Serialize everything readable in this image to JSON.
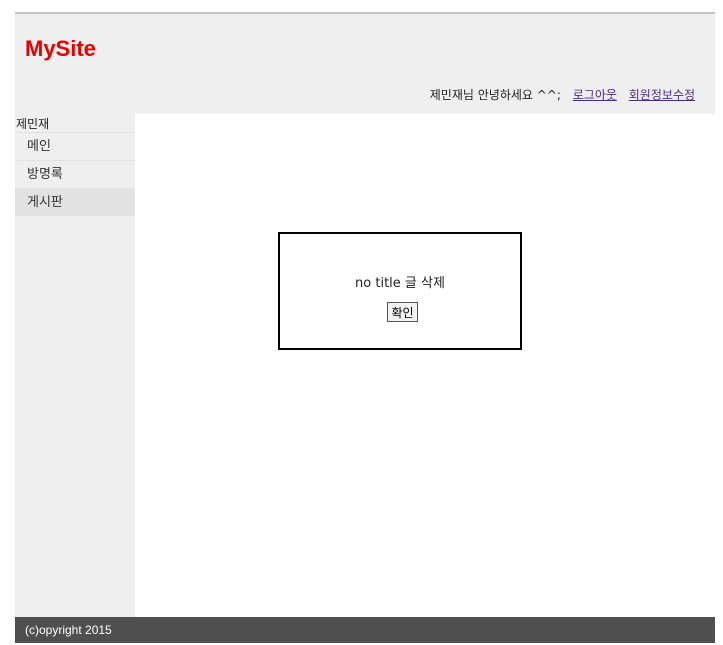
{
  "header": {
    "logo": "MySite",
    "greeting": "제민재님 안녕하세요 ^^;",
    "logout_link": "로그아웃",
    "edit_profile_link": "회원정보수정"
  },
  "sidebar": {
    "user_name": "제민재",
    "items": [
      {
        "label": "메인"
      },
      {
        "label": "방명록"
      },
      {
        "label": "게시판"
      }
    ]
  },
  "dialog": {
    "message": "no title 글 삭제",
    "confirm_label": "확인"
  },
  "footer": {
    "copyright": "(c)opyright 2015"
  },
  "colors": {
    "logo": "#e60000",
    "header_bg": "#efefef",
    "footer_bg": "#4f4f4f",
    "link": "#4a2a88"
  }
}
